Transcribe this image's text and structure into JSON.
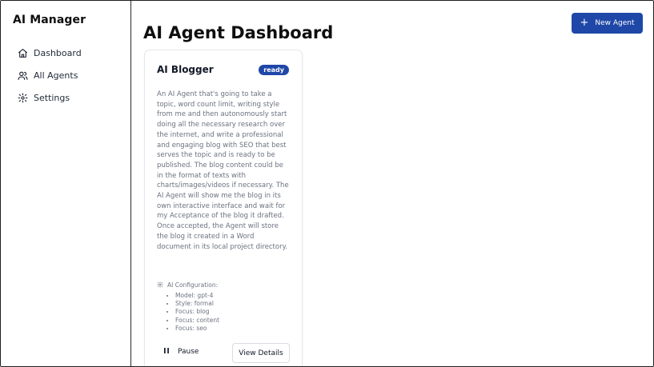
{
  "sidebar": {
    "app_title": "AI Manager",
    "items": [
      {
        "label": "Dashboard",
        "icon": "home-icon"
      },
      {
        "label": "All Agents",
        "icon": "users-icon"
      },
      {
        "label": "Settings",
        "icon": "gear-icon"
      }
    ]
  },
  "header": {
    "title": "AI Agent Dashboard",
    "new_agent_label": "New Agent",
    "new_agent_icon": "plus-icon"
  },
  "agents": [
    {
      "name": "AI Blogger",
      "status": "ready",
      "description": "An AI Agent that's going to take a topic, word count limit, writing style from me and then autonomously start doing all the necessary research over the internet, and write a professional and engaging blog with SEO that best serves the topic and is ready to be published. The blog content could be in the format of texts with charts/images/videos if necessary. The AI Agent will show me the blog in its own interactive interface and wait for my Acceptance of the blog it drafted. Once accepted, the Agent will store the blog it created in a Word document in its local project directory.",
      "config": {
        "heading": "AI Configuration:",
        "items": [
          "Model: gpt-4",
          "Style: formal",
          "Focus: blog",
          "Focus: content",
          "Focus: seo"
        ]
      },
      "actions": {
        "pause_label": "Pause",
        "view_label": "View Details"
      }
    }
  ],
  "colors": {
    "accent": "#1f47a8",
    "muted_text": "#6b7280",
    "border": "#e5e7eb"
  }
}
